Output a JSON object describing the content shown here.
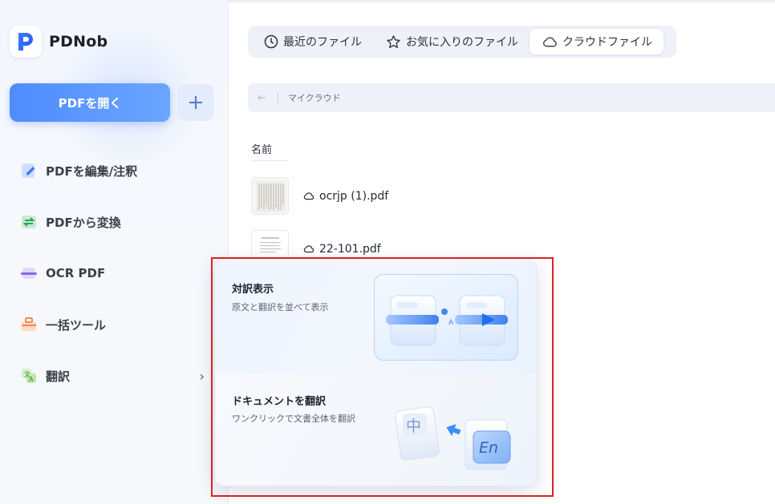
{
  "app": {
    "name": "PDNob"
  },
  "sidebar": {
    "open_button": "PDFを開く",
    "plus_button": "+",
    "items": [
      {
        "label": "PDFを編集/注釈",
        "icon": "edit-icon"
      },
      {
        "label": "PDFから変換",
        "icon": "convert-icon"
      },
      {
        "label": "OCR PDF",
        "icon": "ocr-icon"
      },
      {
        "label": "一括ツール",
        "icon": "toolbox-icon"
      },
      {
        "label": "翻訳",
        "icon": "translate-icon",
        "chevron": "›"
      }
    ]
  },
  "tabs": [
    {
      "label": "最近のファイル",
      "icon": "clock-icon"
    },
    {
      "label": "お気に入りのファイル",
      "icon": "star-icon"
    },
    {
      "label": "クラウドファイル",
      "icon": "cloud-icon",
      "active": true
    }
  ],
  "path": {
    "back": "←",
    "current": "マイクラウド"
  },
  "table": {
    "name_header": "名前"
  },
  "files": [
    {
      "name": "ocrjp (1).pdf"
    },
    {
      "name": "22-101.pdf"
    }
  ],
  "translate_menu": {
    "items": [
      {
        "title": "対訳表示",
        "description": "原文と翻訳を並べて表示"
      },
      {
        "title": "ドキュメントを翻訳",
        "description": "ワンクリックで文書全体を翻訳",
        "illustration_source": "中",
        "illustration_target": "En"
      }
    ]
  },
  "colors": {
    "accent": "#4f8cff",
    "highlight": "#e02020"
  }
}
